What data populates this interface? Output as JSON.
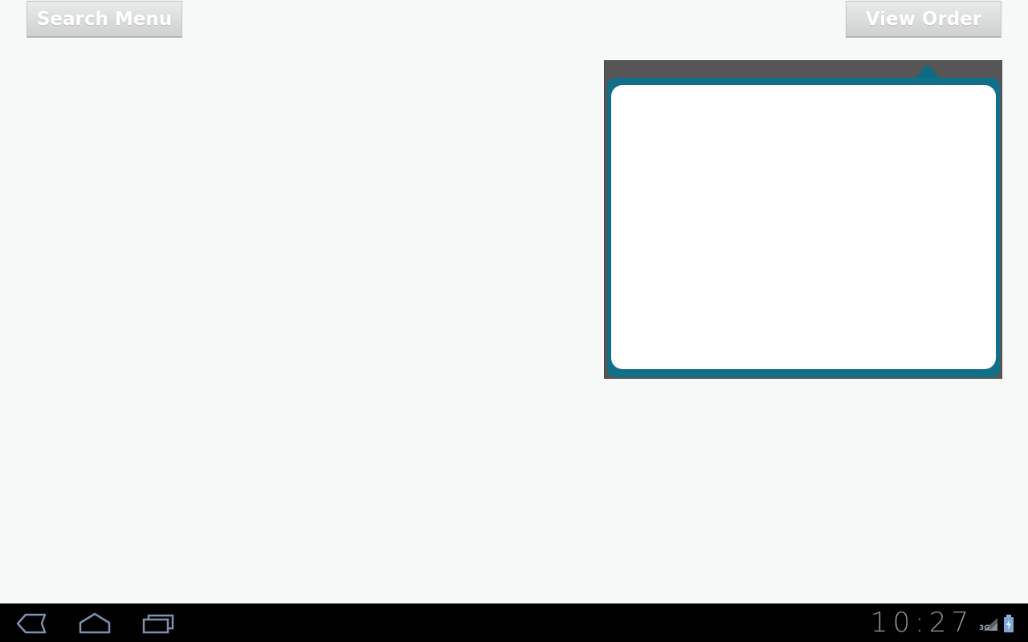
{
  "toolbar": {
    "search_menu_label": "Search Menu",
    "view_order_label": "View Order"
  },
  "popup": {
    "frame_color": "#565656",
    "accent_color": "#10708a"
  },
  "status_bar": {
    "time": "10:27",
    "network_type": "3G"
  },
  "icons": {
    "back": "back-icon",
    "home": "home-icon",
    "recent_apps": "recent-apps-icon",
    "signal": "signal-icon",
    "battery": "battery-charging-icon"
  }
}
